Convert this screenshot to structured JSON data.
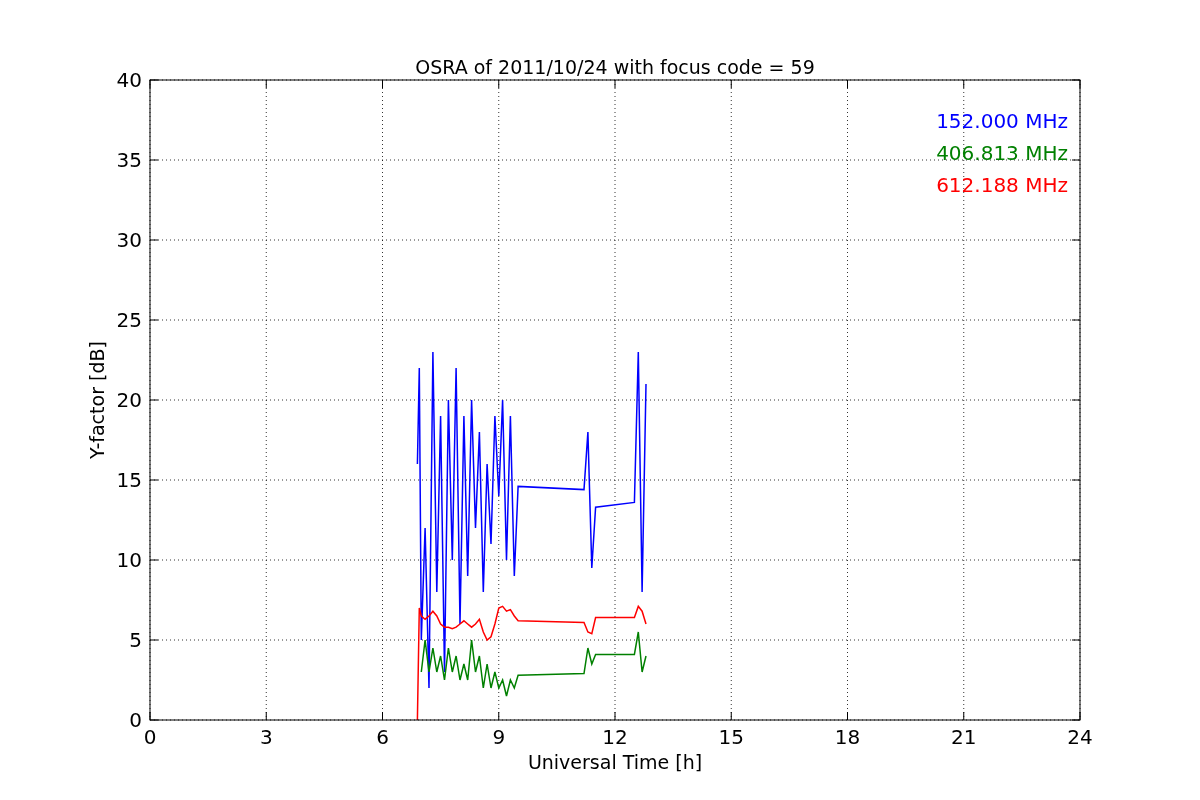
{
  "chart": {
    "chart_data": {
      "type": "line",
      "title": "OSRA of 2011/10/24 with focus code = 59",
      "xlabel": "Universal Time [h]",
      "ylabel": "Y-factor [dB]",
      "x": [
        6.9,
        6.95,
        7.0,
        7.1,
        7.2,
        7.3,
        7.4,
        7.5,
        7.6,
        7.7,
        7.8,
        7.9,
        8.0,
        8.1,
        8.2,
        8.3,
        8.4,
        8.5,
        8.6,
        8.7,
        8.8,
        8.9,
        9.0,
        9.1,
        9.2,
        9.3,
        9.4,
        9.5,
        11.2,
        11.3,
        11.4,
        11.5,
        12.5,
        12.6,
        12.7,
        12.8
      ],
      "series": [
        {
          "name": "152.000 MHz",
          "color": "#0000ff",
          "values": [
            16,
            22,
            5,
            12,
            2,
            23,
            8,
            19,
            3,
            20,
            10,
            22,
            6,
            19,
            9,
            20,
            12,
            18,
            8,
            16,
            11,
            19,
            14,
            20,
            10,
            19,
            9,
            14.6,
            14.4,
            18,
            9.5,
            13.3,
            13.6,
            23,
            8,
            21
          ]
        },
        {
          "name": "406.813 MHz",
          "color": "#008000",
          "values": [
            null,
            null,
            3,
            5,
            3,
            4.5,
            3,
            4,
            2.5,
            4.5,
            3,
            4,
            2.5,
            3.5,
            2.5,
            5,
            3,
            4,
            2,
            3.5,
            2,
            3,
            2,
            2.5,
            1.5,
            2.5,
            2,
            2.8,
            2.9,
            4.5,
            3.5,
            4.1,
            4.1,
            5.5,
            3,
            4
          ]
        },
        {
          "name": "612.188 MHz",
          "color": "#ff0000",
          "values": [
            0,
            7,
            6.5,
            6.3,
            6.5,
            6.8,
            6.5,
            6,
            5.8,
            5.8,
            5.7,
            5.8,
            6,
            6.2,
            6,
            5.8,
            6,
            6.3,
            5.5,
            5,
            5.2,
            6,
            7,
            7.1,
            6.8,
            6.9,
            6.5,
            6.2,
            6.1,
            5.5,
            5.4,
            6.4,
            6.4,
            7.1,
            6.8,
            6
          ]
        }
      ],
      "grid": true,
      "xlim": [
        0,
        24
      ],
      "ylim": [
        0,
        40
      ],
      "xticks": [
        0,
        3,
        6,
        9,
        12,
        15,
        18,
        21,
        24
      ],
      "yticks": [
        0,
        5,
        10,
        15,
        20,
        25,
        30,
        35,
        40
      ]
    }
  }
}
